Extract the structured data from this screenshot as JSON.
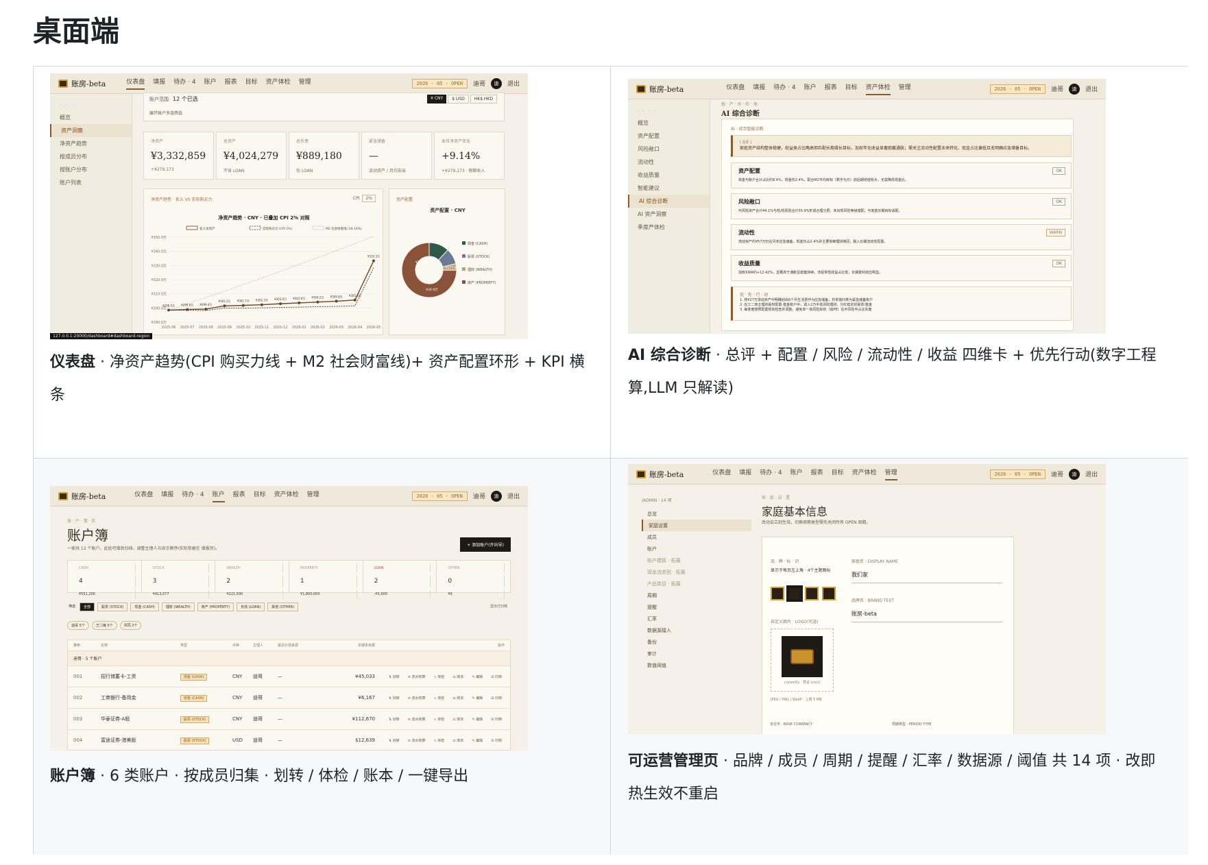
{
  "heading": "桌面端",
  "captions": {
    "dashboard": {
      "bold": "仪表盘",
      "text": " · 净资产趋势(CPI 购买力线 + M2 社会财富线)+ 资产配置环形 + KPI 横条"
    },
    "ai": {
      "bold": "AI 综合诊断",
      "text": " · 总评 + 配置 / 风险 / 流动性 / 收益 四维卡 + 优先行动(数字工程算,LLM 只解读)"
    },
    "accounts": {
      "bold": "账户簿",
      "text": " · 6 类账户 · 按成员归集 · 划转 / 体检 / 账本 / 一键导出"
    },
    "admin": {
      "bold": "可运营管理页",
      "text": " · 品牌 / 成员 / 周期 / 提醒 / 汇率 / 数据源 / 阈值 共 14 项 · 改即热生效不重启"
    }
  },
  "app": {
    "logo": "账房-beta",
    "period": "2026 · 05 · OPEN",
    "user": "迪哥",
    "avatar": "迪",
    "logout": "退出",
    "nav": [
      "仪表盘",
      "填报",
      "待办 · 4",
      "账户",
      "报表",
      "目标",
      "资产体检",
      "管理"
    ]
  },
  "dashboard": {
    "sidebar": [
      "概览",
      "资产洞察",
      "净资产趋势",
      "按成员分布",
      "按账户分布",
      "账户列表"
    ],
    "filter_label": "账户范围",
    "filter_value": "12 个已选",
    "filter_hint": "展开账户多选筛选",
    "currency": [
      "¥ CNY",
      "$ USD",
      "HK$ HKD"
    ],
    "kpis": [
      {
        "label": "净资产",
        "value": "¥3,332,859",
        "sub": "+¥279,173"
      },
      {
        "label": "总资产",
        "value": "¥4,024,279",
        "sub": "不含 LOAN"
      },
      {
        "label": "总负债",
        "value": "¥889,180",
        "sub": "仅 LOAN"
      },
      {
        "label": "紧急储备",
        "value": "—",
        "sub": "流动资产 / 月均支出"
      },
      {
        "label": "本月净资产变化",
        "value": "+9.14%",
        "sub": "+¥279,173 · 假期收入"
      }
    ],
    "trend_panel": "净资产趋势 · 名义 VS 实际购买力",
    "url": "127.0.0.1:20000/dashboard#dashboard-region",
    "alloc_panel": "资产配置",
    "alloc_title": "资产配置 · CNY",
    "alloc_legend": [
      "现金 (CASH)",
      "股票 (STOCK)",
      "理财 (WEALTH)",
      "房产 (PROPERTY)"
    ],
    "cpi_label": "CPI",
    "cpi_value": "2%"
  },
  "chart_data": {
    "type": "line",
    "title": "净资产趋势 · CNY · 已叠加 CPI 2% 对照",
    "x": [
      "2025-06",
      "2025-07",
      "2025-08",
      "2025-09",
      "2025-10",
      "2025-11",
      "2025-12",
      "2026-01",
      "2026-02",
      "2026-03",
      "2026-04",
      "2026-05"
    ],
    "series": [
      {
        "name": "名义净资产",
        "values": [
          298.5,
          298.9,
          299.2,
          301.5,
          301.8,
          302.3,
          303.0,
          303.6,
          304.2,
          304.8,
          305.6,
          333.3
        ]
      },
      {
        "name": "实际购买力 (CPI 2%)",
        "values": [
          298.5,
          298.4,
          298.2,
          300.0,
          299.9,
          300.1,
          300.4,
          300.6,
          300.9,
          301.1,
          301.5,
          328.5
        ]
      },
      {
        "name": "M2 社会财富线 (18.16%)",
        "values": [
          298.5,
          302.9,
          307.4,
          311.9,
          316.5,
          321.2,
          325.9,
          330.7,
          335.6,
          340.5,
          345.5,
          350.6
        ]
      }
    ],
    "ylabel": "",
    "y_ticks": [
      "¥290.0万",
      "¥300.0万",
      "¥310.0万",
      "¥320.0万",
      "¥330.0万",
      "¥340.0万",
      "¥350.0万"
    ],
    "ylim": [
      290,
      350
    ],
    "point_labels": [
      "¥298.5万",
      "¥299.6万",
      "¥299.4万",
      "¥301.5万",
      "¥301.7万",
      "¥302.3万",
      "¥303.0万",
      "¥303.6万",
      "¥304.2万",
      "¥304.8万",
      "¥305.6万",
      "¥333.3万"
    ],
    "donut": {
      "type": "pie",
      "labels": [
        "现金 (CASH)",
        "股票 (STOCK)",
        "理财 (WEALTH)",
        "房产 (PROPERTY)"
      ],
      "values": [
        11.9,
        9.4,
        3.8,
        74.9
      ],
      "colors": [
        "#2f5a4a",
        "#6a7a96",
        "#b8a57a",
        "#8a5238"
      ],
      "slice_labels": [
        "¥190.0万",
        "¥177.9万",
        "¥34.9万"
      ]
    }
  },
  "ai": {
    "sidebar": [
      "概览",
      "资产配置",
      "风险敞口",
      "流动性",
      "收益质量",
      "智能建议",
      "AI 综合诊断",
      "AI 资产洞察",
      "季度产体检"
    ],
    "breadcrumb": "报 · 产 · 体 · 检 · 角",
    "title": "AI 综合诊断",
    "header_label": "AI · 综合智能诊断",
    "summary_label": "[ 总评 ]",
    "summary": "家庭资产结构整体稳健，权益类占比略高但匹配长期增长目标，加权年化收益显著跑赢通胀；需关注流动性配置未来转化，现金占比偏低且无明确应急储备目标。",
    "cards": [
      {
        "title": "资产配置",
        "badge": "OK",
        "text": "现金与账户合计占比约8.4%，现金仅2.4%，配合M2平均目标（数字为万）前后期增值较大，无需降低现金比。"
      },
      {
        "title": "风险敞口",
        "badge": "OK",
        "text": "中风险资产合计44.1%与低/低风险合计55.9%形成合理分层，未出现风险等级错配，与家庭长期目标适配。"
      },
      {
        "title": "流动性",
        "badge": "WARN",
        "text": "流动资产约¥57万仍在月末应急储备，现金仅占2.4%并主要依赖理财赎回，融入长期流动性配置。"
      },
      {
        "title": "收益质量",
        "badge": "OK",
        "text": "加权XIRR约+12.42%，显著高于通胀且稳健持续，非经常性收益占比低，长期复利效应明显。"
      }
    ],
    "actions_label": "优 · 先 · 行 · 动",
    "actions": [
      "1. 将¥27万流动资产中明确划出6个月生活费作为应急储备，并单独归类为紧急储备账户",
      "2. 在工二商主理的股权配置-基金账户中，调入2万中低风险理财，分红稳定的股票/基金",
      "3. 每季度按照配置规划检查并调整，避免单一高风险标的（如PE）在中风险中占比失衡"
    ]
  },
  "accounts": {
    "breadcrumb": "账 · 户 · 簿 · 页",
    "title": "账户簿",
    "subtitle": "一家共 12 个账户。此处可增改归档，调整主理人与显示顺序(实际依据在 填报页)。",
    "add_button": "+ 添加账户(开向导)",
    "summary": [
      {
        "label": "CASH",
        "count": "4",
        "amount": "¥551,200"
      },
      {
        "label": "STOCK",
        "count": "3",
        "amount": "¥413,077"
      },
      {
        "label": "WEALTH",
        "count": "2",
        "amount": "¥221,500"
      },
      {
        "label": "PROPERTY",
        "count": "1",
        "amount": "¥1,800,000"
      },
      {
        "label": "LOAN",
        "count": "2",
        "amount": "-¥3,600"
      },
      {
        "label": "OTHER",
        "count": "0",
        "amount": "¥0"
      }
    ],
    "filter_label": "筛选",
    "chips": [
      "全部",
      "股票 (STOCK)",
      "现金 (CASH)",
      "理财 (WEALTH)",
      "房产 (PROPERTY)",
      "负债 (LOAN)",
      "其他 (OTHER)"
    ],
    "show_archived": "显示已归档",
    "members": [
      "迪哥 5个",
      "王二梅 5个",
      "共同 2个"
    ],
    "columns": [
      "排序",
      "名称",
      "类型",
      "币种",
      "主理人",
      "最近价值来源",
      "本期末余额",
      "操作"
    ],
    "group": "迪哥 · 5 个账户",
    "rows": [
      {
        "no": "001",
        "name": "招行储蓄卡-工资",
        "type": "现金 (CASH)",
        "cur": "CNY",
        "owner": "迪哥",
        "src": "—",
        "amount": "¥45,033"
      },
      {
        "no": "002",
        "name": "工商银行-备用金",
        "type": "现金 (CASH)",
        "cur": "CNY",
        "owner": "迪哥",
        "src": "—",
        "amount": "¥6,167"
      },
      {
        "no": "003",
        "name": "华泰证券-A股",
        "type": "股票 (STOCK)",
        "cur": "CNY",
        "owner": "迪哥",
        "src": "—",
        "amount": "¥112,670"
      },
      {
        "no": "004",
        "name": "富途证券-港美股",
        "type": "股票 (STOCK)",
        "cur": "USD",
        "owner": "迪哥",
        "src": "—",
        "amount": "$12,639"
      }
    ],
    "ops": [
      "⇅ 划转",
      "≡ 流水核算",
      "∿ 体检",
      "⚖ 账本",
      "✎ 编辑",
      "⊟ 归档"
    ]
  },
  "admin": {
    "path": "/ADMIN · 14 项",
    "sidebar": [
      "总览",
      "家庭设置",
      "成员",
      "账户",
      "账户模板 · 拓展",
      "现金流类别 · 拓展",
      "产品类目 · 拓展",
      "周期",
      "提醒",
      "汇率",
      "数据源接入",
      "备份",
      "审计",
      "数值阈值"
    ],
    "breadcrumb": "家 · 庭 · 设 · 置",
    "title": "家庭基本信息",
    "subtitle": "改动会立刻生效。切换周期类型需先关闭所有 OPEN 周期。",
    "icon_label": "品 · 牌 · 标 · 识",
    "icon_hint": "显示于每页左上角 · 4个主题图标",
    "display_label": "家庭名 · DISPLAY NAME",
    "display_value": "我们家",
    "brand_label": "品牌名 · BRAND TEXT",
    "brand_value": "账房-beta",
    "logo_label": "自定义图片 · LOGO(可选)",
    "logo_caption": "currently · 预设 icon2",
    "logo_note": "JPEG / PNG / WebP · 上限 5 MB",
    "base_currency": "本位币 · BASE CURRENCY",
    "period_type": "周期类型 · PERIOD TYPE"
  }
}
